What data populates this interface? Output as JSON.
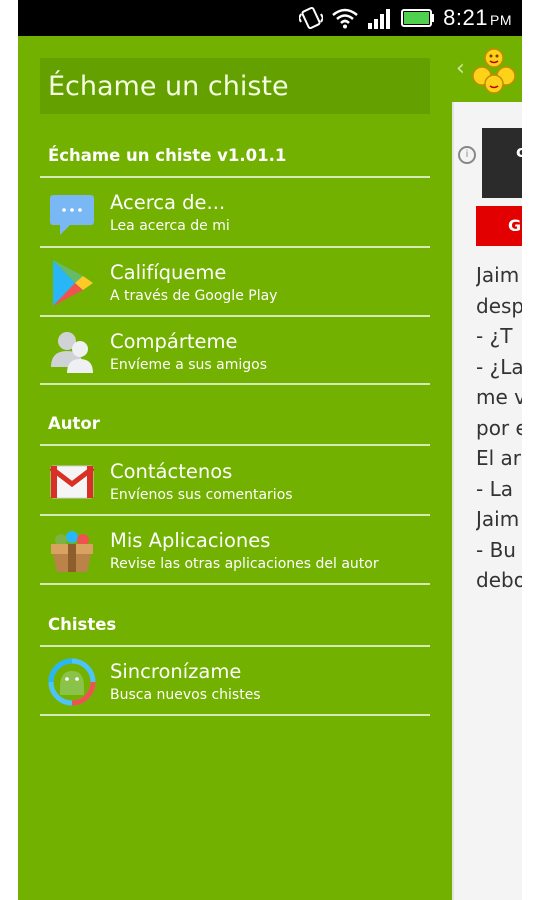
{
  "status_bar": {
    "time": "8:21",
    "ampm": "PM"
  },
  "drawer": {
    "title": "Échame un chiste",
    "sections": [
      {
        "title": "Échame un chiste v1.01.1",
        "items": [
          {
            "title": "Acerca de...",
            "subtitle": "Lea acerca de mi",
            "icon": "chat-bubble-icon"
          },
          {
            "title": "Califíqueme",
            "subtitle": "A través de Google Play",
            "icon": "google-play-icon"
          },
          {
            "title": "Compárteme",
            "subtitle": "Envíeme a sus amigos",
            "icon": "people-icon"
          }
        ]
      },
      {
        "title": "Autor",
        "items": [
          {
            "title": "Contáctenos",
            "subtitle": "Envíenos sus comentarios",
            "icon": "gmail-icon"
          },
          {
            "title": "Mis Aplicaciones",
            "subtitle": "Revise las otras aplicaciones del autor",
            "icon": "gift-box-icon"
          }
        ]
      },
      {
        "title": "Chistes",
        "items": [
          {
            "title": "Sincronízame",
            "subtitle": "Busca nuevos chistes",
            "icon": "sync-android-icon"
          }
        ]
      }
    ]
  },
  "background": {
    "back_glyph": "‹",
    "ad_text": "c",
    "ad_info": "i",
    "button_text": "G",
    "joke_lines": [
      "Jaim",
      "desp",
      "- ¿T",
      "- ¿La",
      "me v",
      "por e",
      "El ar",
      "- La",
      "Jaim",
      "- Bu",
      "debo"
    ]
  },
  "colors": {
    "drawer_bg": "#72b100",
    "header_bg": "#64a000",
    "ad_red": "#e30000"
  }
}
